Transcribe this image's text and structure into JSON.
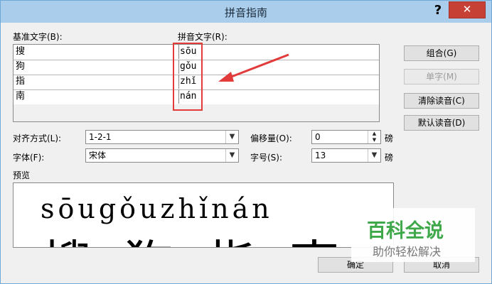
{
  "window": {
    "title": "拼音指南",
    "help_label": "?",
    "close_label": "✕"
  },
  "labels": {
    "base_text": "基准文字(B):",
    "pinyin_text": "拼音文字(R):",
    "alignment": "对齐方式(L):",
    "offset": "偏移量(O):",
    "font": "字体(F):",
    "font_size": "字号(S):",
    "preview": "预览",
    "offset_unit": "磅",
    "size_unit": "磅"
  },
  "rows": [
    {
      "base": "搜",
      "pinyin": "sōu"
    },
    {
      "base": "狗",
      "pinyin": "gǒu"
    },
    {
      "base": "指",
      "pinyin": "zhǐ"
    },
    {
      "base": "南",
      "pinyin": "nán"
    },
    {
      "base": "",
      "pinyin": ""
    }
  ],
  "buttons": {
    "group": "组合(G)",
    "single_char": "单字(M)",
    "clear_pinyin": "清除读音(C)",
    "default_pinyin": "默认读音(D)",
    "ok": "确定",
    "cancel": "取消"
  },
  "controls": {
    "alignment_value": "1-2-1",
    "offset_value": "0",
    "font_value": "宋体",
    "font_size_value": "13"
  },
  "preview": {
    "pinyin_line": "sōugǒuzhǐnán",
    "chars_line": "搜狗指南"
  },
  "watermark": {
    "title": "百科全说",
    "subtitle": "助你轻松解决"
  },
  "colors": {
    "titlebar": "#a9cdea",
    "close": "#c74036",
    "highlight": "#e23b3b",
    "watermark": "#3ea84a"
  }
}
